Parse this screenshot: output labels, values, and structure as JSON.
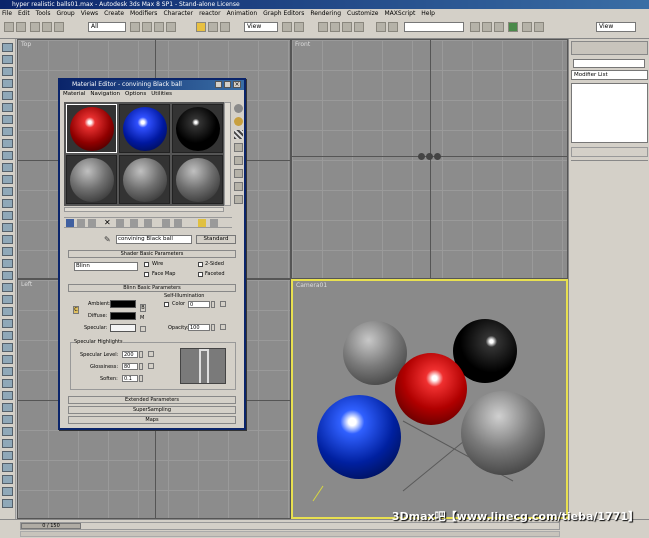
{
  "window": {
    "title": "hyper realistic balls01.max - Autodesk 3ds Max 8 SP1 - Stand-alone License"
  },
  "menu": [
    "File",
    "Edit",
    "Tools",
    "Group",
    "Views",
    "Create",
    "Modifiers",
    "Character",
    "reactor",
    "Animation",
    "Graph Editors",
    "Rendering",
    "Customize",
    "MAXScript",
    "Help"
  ],
  "toolbar": {
    "selection_filter": "All",
    "ref_coord": "View",
    "named_sel": "",
    "render_type": "View"
  },
  "viewports": {
    "top": "Top",
    "front": "Front",
    "left": "Left",
    "camera": "Camera01"
  },
  "right_panel": {
    "modifier_list": "Modifier List"
  },
  "material_editor": {
    "title": "Material Editor - convining Black ball",
    "menu": [
      "Material",
      "Navigation",
      "Options",
      "Utilities"
    ],
    "material_name": "convining Black ball",
    "material_type": "Standard",
    "shader_rollout": "Shader Basic Parameters",
    "shader": "Blinn",
    "wire": "Wire",
    "two_sided": "2-Sided",
    "face_map": "Face Map",
    "faceted": "Faceted",
    "blinn_rollout": "Blinn Basic Parameters",
    "self_illum": "Self-Illumination",
    "color_label": "Color",
    "color_value": "0",
    "ambient": "Ambient:",
    "diffuse": "Diffuse:",
    "specular": "Specular:",
    "opacity_label": "Opacity:",
    "opacity_value": "100",
    "spec_highlights": "Specular Highlights",
    "spec_level_label": "Specular Level:",
    "spec_level_value": "200",
    "glossiness_label": "Glossiness:",
    "glossiness_value": "80",
    "soften_label": "Soften:",
    "soften_value": "0.1",
    "extended": "Extended Parameters",
    "supersampling": "SuperSampling",
    "maps": "Maps",
    "lock_m": "M",
    "lock_c": "C",
    "lock_b": "B"
  },
  "timeline": {
    "frame": "0 / 150"
  },
  "watermark": "3Dmax吧【www.linecg.com/tieba/1771】",
  "colors": {
    "red": "#d81818",
    "blue": "#1040d8",
    "black": "#050505",
    "grey": "#7a7a7a",
    "highlight": "#f0f078"
  }
}
